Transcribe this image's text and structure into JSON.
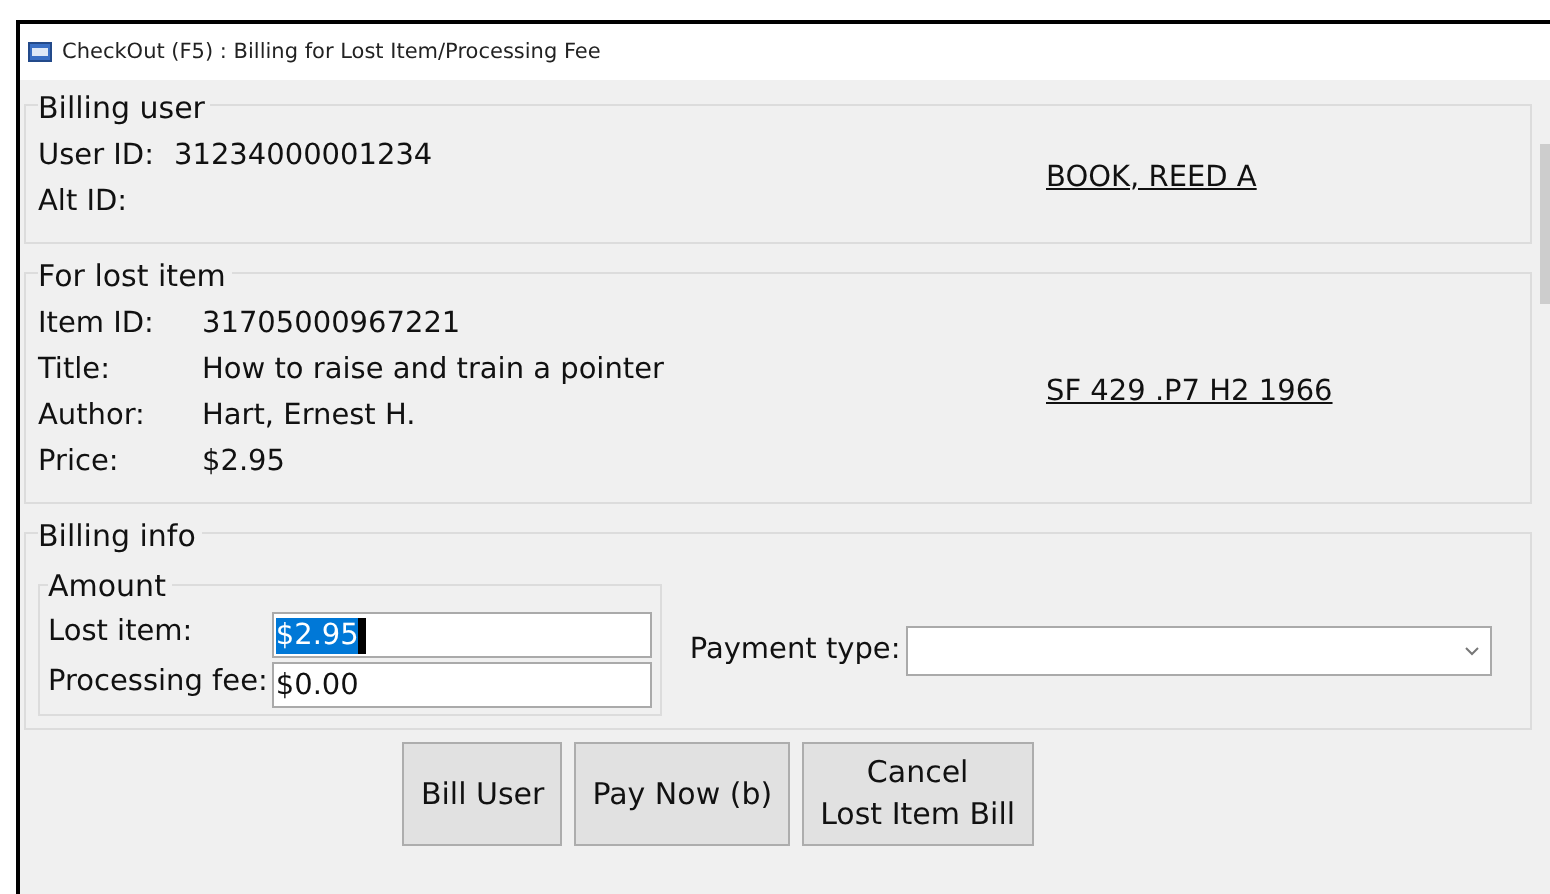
{
  "window": {
    "title": "CheckOut (F5) : Billing for Lost Item/Processing Fee"
  },
  "billing_user": {
    "legend": "Billing user",
    "fields": [
      {
        "label": "User ID:",
        "value": "31234000001234"
      },
      {
        "label": "Alt ID:"
      }
    ],
    "name_link": "BOOK, REED A"
  },
  "lost_item": {
    "legend": "For lost item",
    "fields": [
      {
        "label": "Item ID:",
        "value": "31705000967221"
      },
      {
        "label": "Title:",
        "value": "How to raise and train a pointer"
      },
      {
        "label": "Author:",
        "value": "Hart, Ernest H."
      },
      {
        "label": "Price:",
        "value": "$2.95"
      }
    ],
    "call_number_link": "SF 429 .P7 H2 1966"
  },
  "billing_info": {
    "legend": "Billing info",
    "amount": {
      "legend": "Amount",
      "fields": [
        {
          "label": "Lost item:",
          "value": "$2.95",
          "text_selected": true
        },
        {
          "label": "Processing fee:",
          "value": "$0.00",
          "text_selected": false
        }
      ]
    },
    "payment_type": {
      "label": "Payment type:"
    }
  },
  "buttons": [
    {
      "label": "Bill User"
    },
    {
      "label": "Pay Now (b)"
    },
    {
      "label": "Cancel\nLost Item Bill"
    }
  ]
}
